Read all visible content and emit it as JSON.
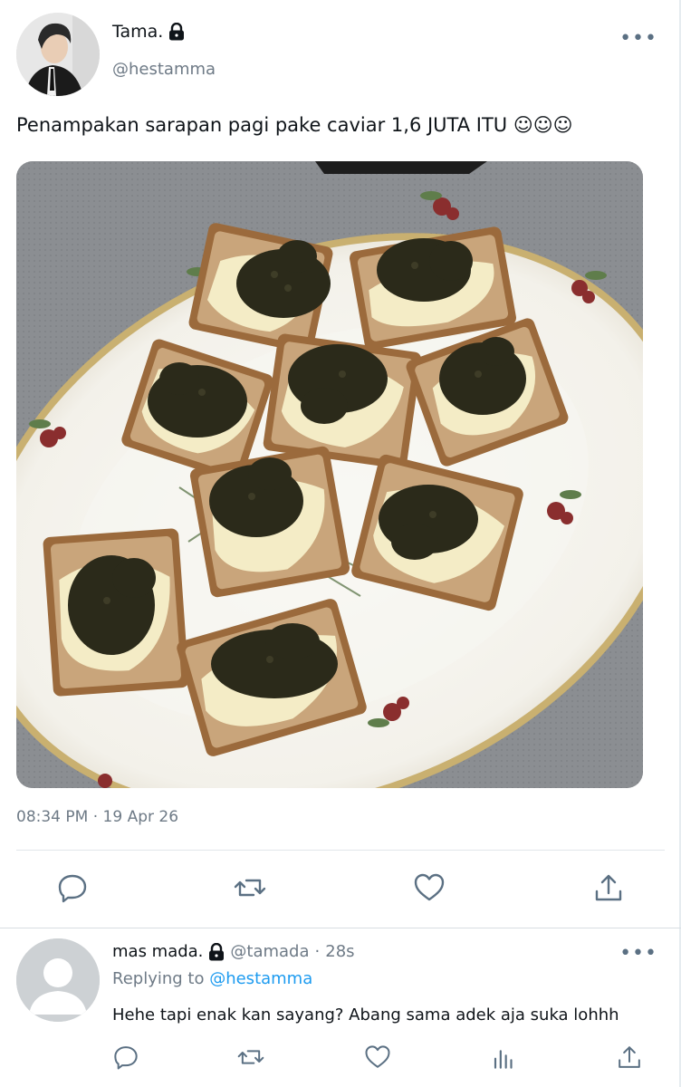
{
  "tweet": {
    "author_name": "Tama.",
    "author_handle": "@hestamma",
    "text": "Penampakan sarapan pagi pake caviar 1,6 JUTA ITU ☺☺☺",
    "time": "08:34 PM",
    "date": "19 Apr 26",
    "meta_separator": "·",
    "more_label": "•••"
  },
  "reply": {
    "author_name": "mas mada.",
    "author_handle": "@tamada",
    "separator": "·",
    "age": "28s",
    "replying_prefix": "Replying to ",
    "replying_to": "@hestamma",
    "text": "Hehe tapi enak kan sayang? Abang sama adek aja suka lohhh",
    "more_label": "•••"
  },
  "icons": {
    "lock": "lock-icon",
    "reply": "reply-icon",
    "retweet": "retweet-icon",
    "like": "like-icon",
    "share": "share-icon",
    "analytics": "analytics-icon"
  },
  "colors": {
    "text": "#0f1419",
    "muted": "#6e7a86",
    "link": "#1d9bf0",
    "icon": "#5b7083"
  }
}
